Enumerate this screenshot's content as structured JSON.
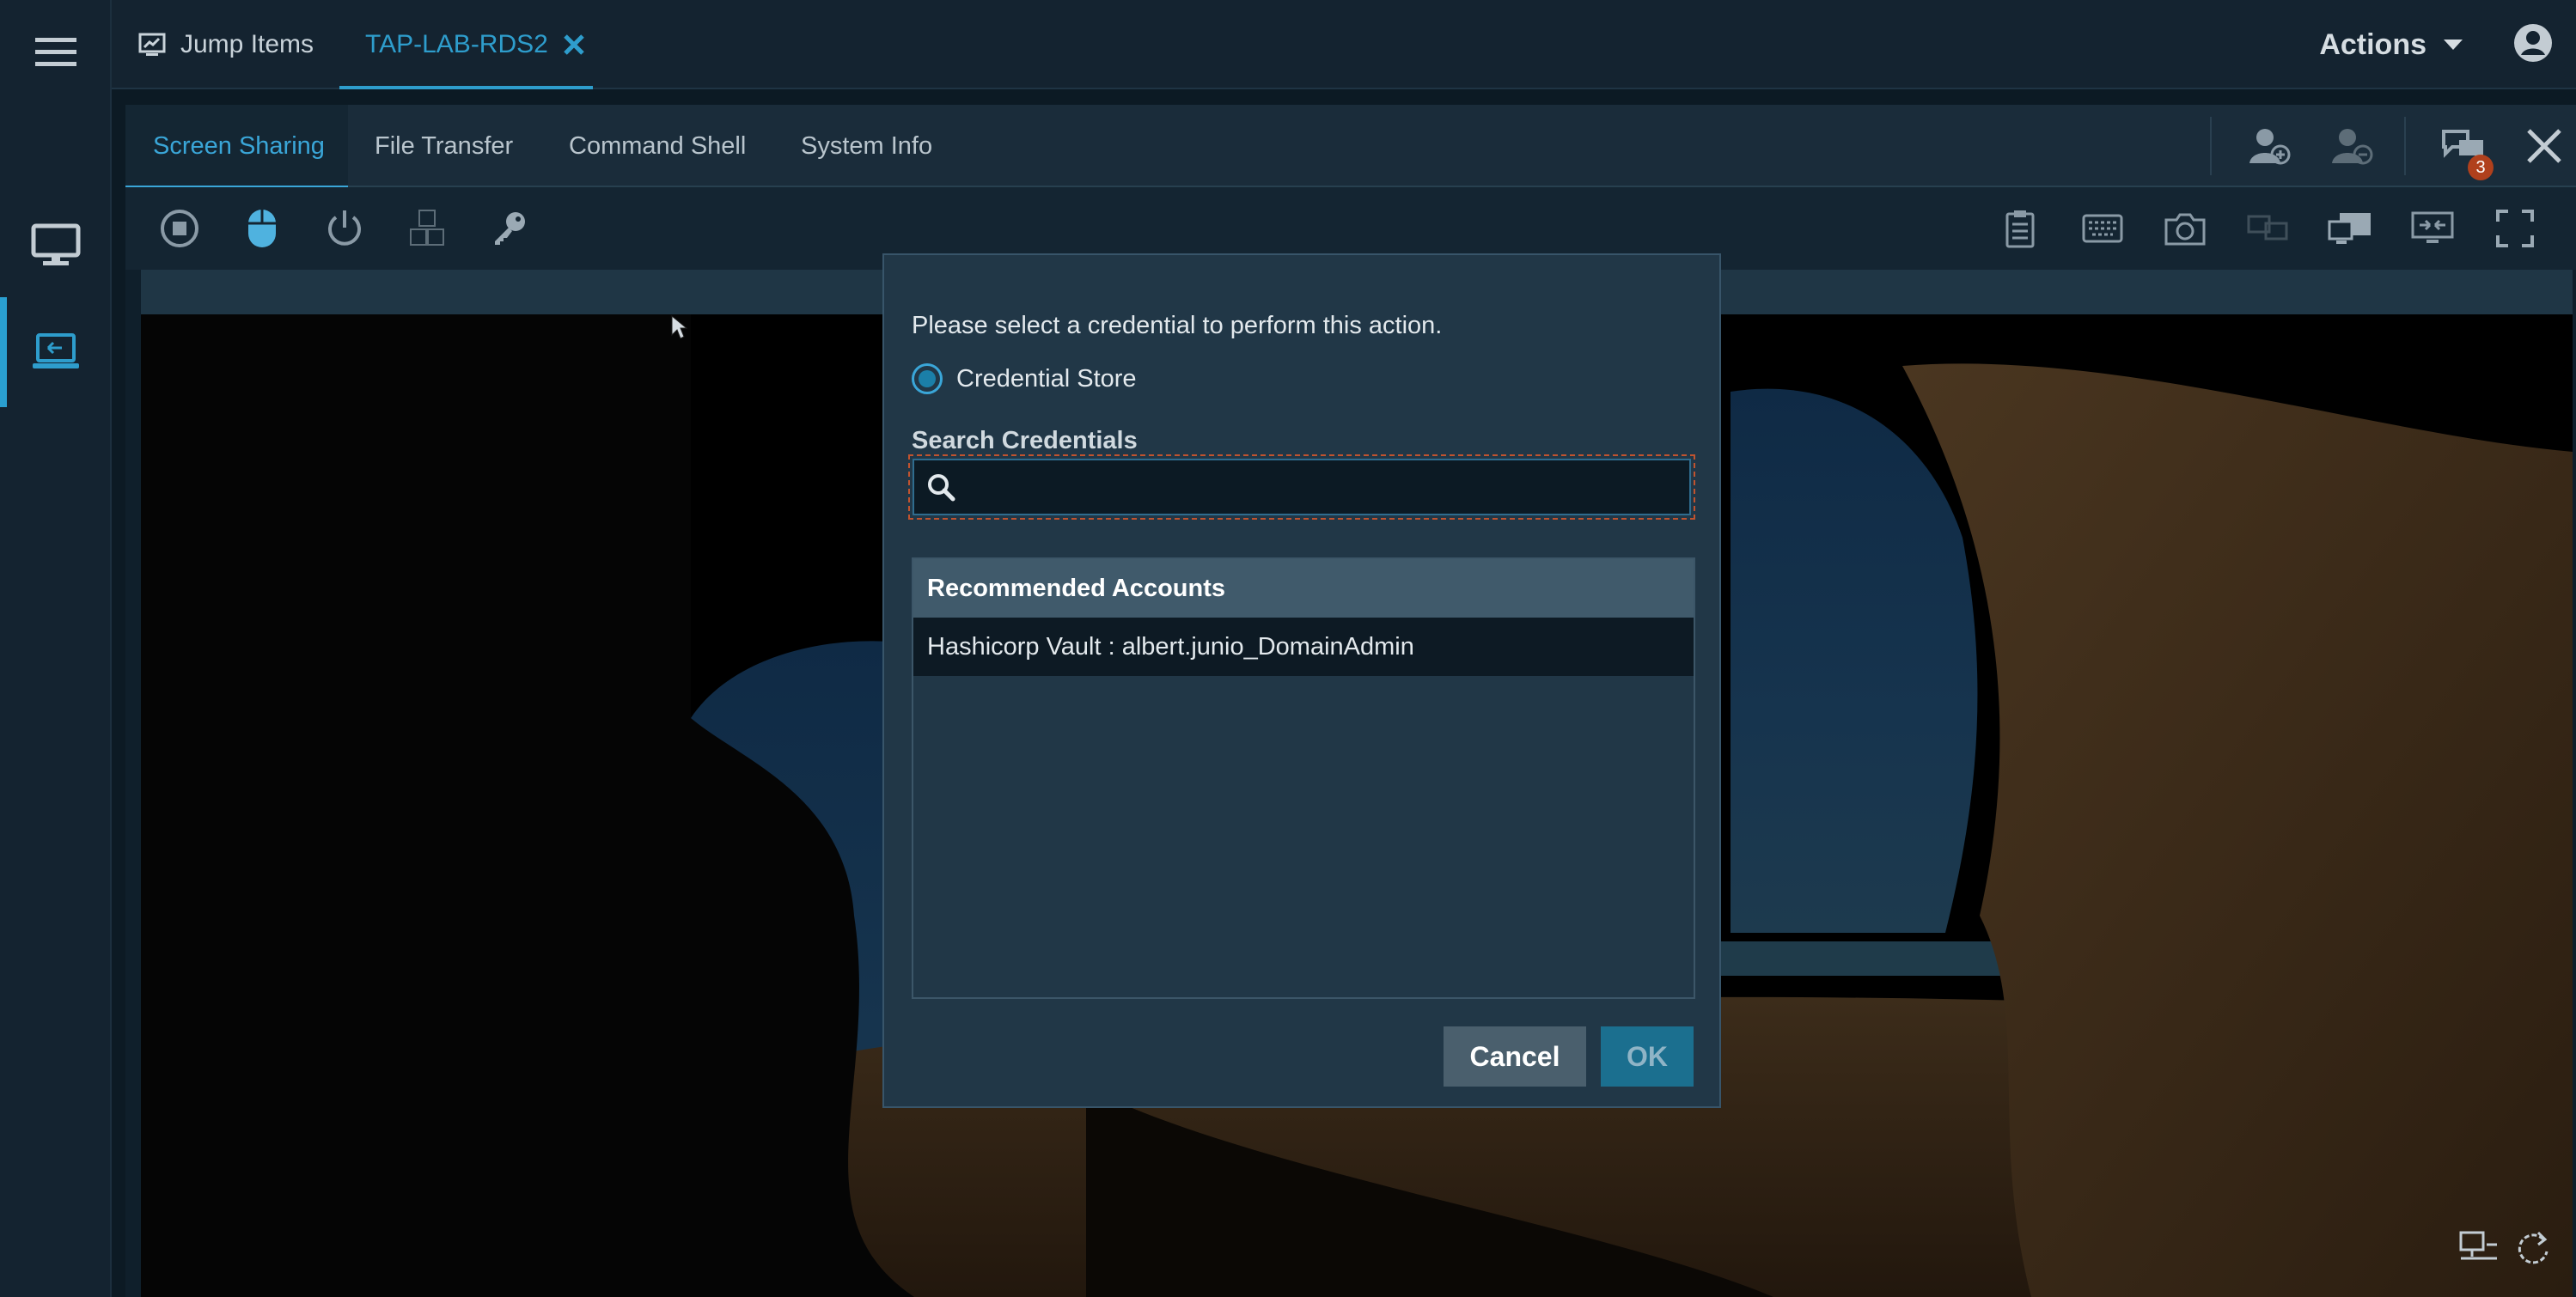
{
  "header": {
    "tabs": [
      {
        "label": "Jump Items",
        "icon": "jump-items-icon"
      },
      {
        "label": "TAP-LAB-RDS2",
        "icon": "close-icon"
      }
    ],
    "actions_label": "Actions",
    "accent": "#2e9dcc"
  },
  "session": {
    "tabs": [
      "Screen Sharing",
      "File Transfer",
      "Command Shell",
      "System Info"
    ],
    "chat_badge": "3"
  },
  "dialog": {
    "prompt": "Please select a credential to perform this action.",
    "source_option": "Credential Store",
    "search_label": "Search Credentials",
    "search_value": "",
    "accounts_header": "Recommended Accounts",
    "accounts": [
      "Hashicorp Vault : albert.junio_DomainAdmin"
    ],
    "cancel_label": "Cancel",
    "ok_label": "OK"
  }
}
